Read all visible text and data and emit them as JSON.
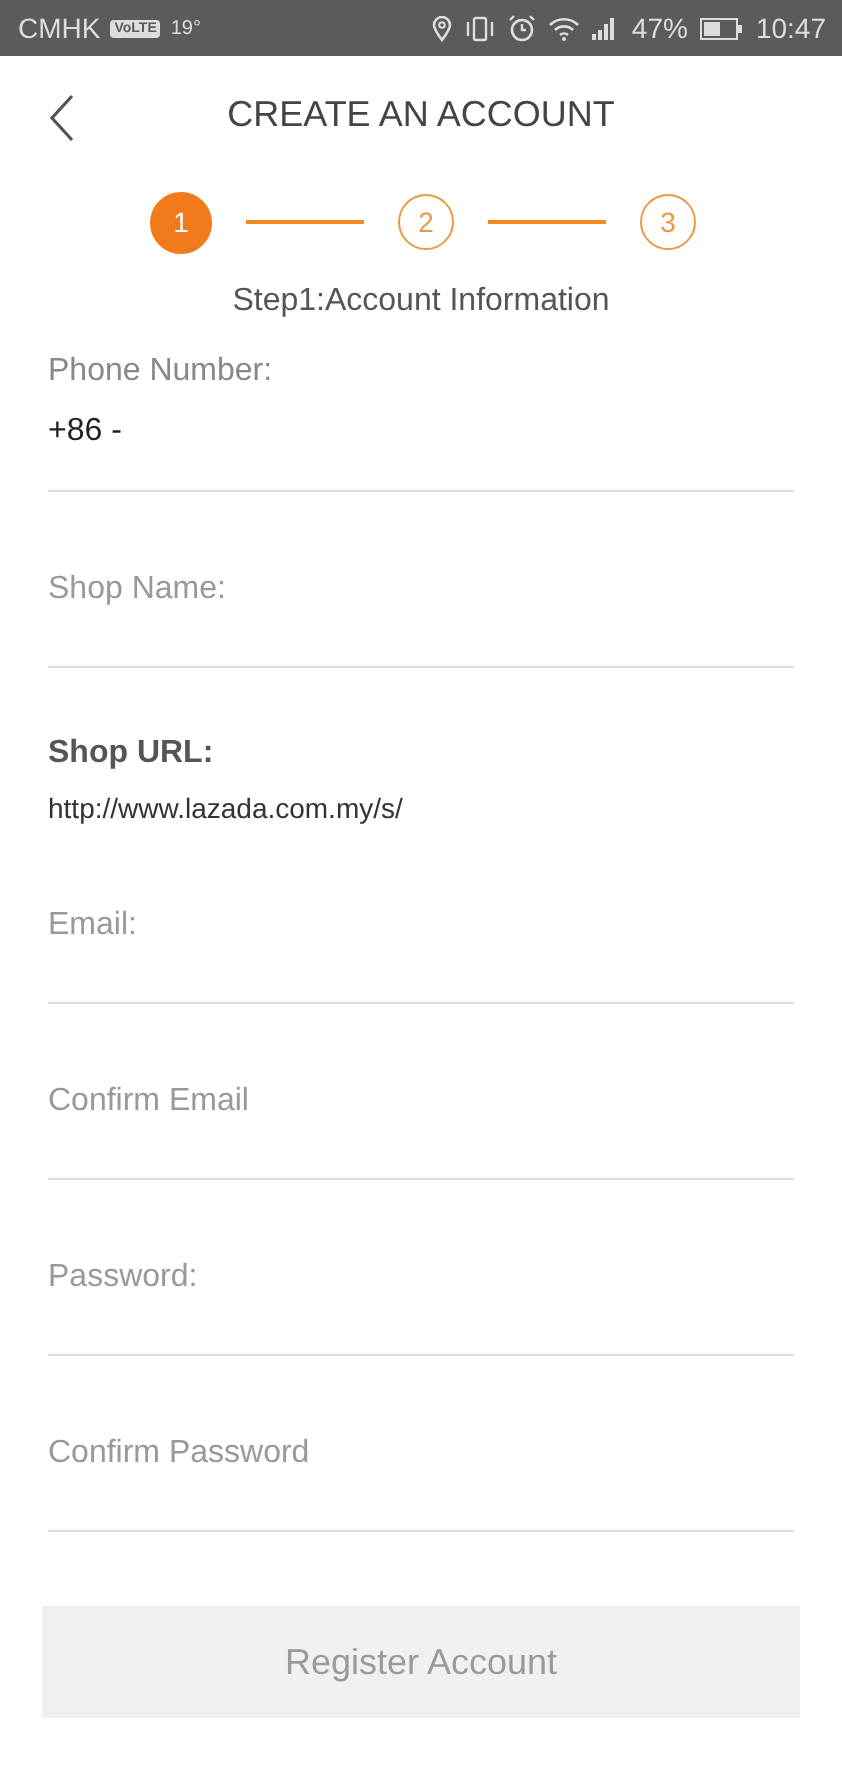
{
  "status_bar": {
    "carrier": "CMHK",
    "network_badge": "VoLTE",
    "temperature": "19°",
    "battery": "47%",
    "time": "10:47"
  },
  "header": {
    "title": "CREATE AN ACCOUNT"
  },
  "steps": [
    {
      "label": "1",
      "selected": true
    },
    {
      "label": "2",
      "selected": false
    },
    {
      "label": "3",
      "selected": false
    }
  ],
  "step_title": "Step1:Account Information",
  "fields": [
    {
      "kind": "labeled",
      "label": "Phone Number:",
      "value": "+86 -"
    },
    {
      "kind": "input",
      "placeholder": "Shop Name:"
    },
    {
      "kind": "static",
      "label": "Shop URL:",
      "value": "http://www.lazada.com.my/s/"
    },
    {
      "kind": "input",
      "placeholder": "Email:"
    },
    {
      "kind": "input",
      "placeholder": "Confirm Email"
    },
    {
      "kind": "input",
      "placeholder": "Password:"
    },
    {
      "kind": "input",
      "placeholder": "Confirm Password"
    }
  ],
  "register_button": {
    "label": "Register Account",
    "disabled": true
  }
}
